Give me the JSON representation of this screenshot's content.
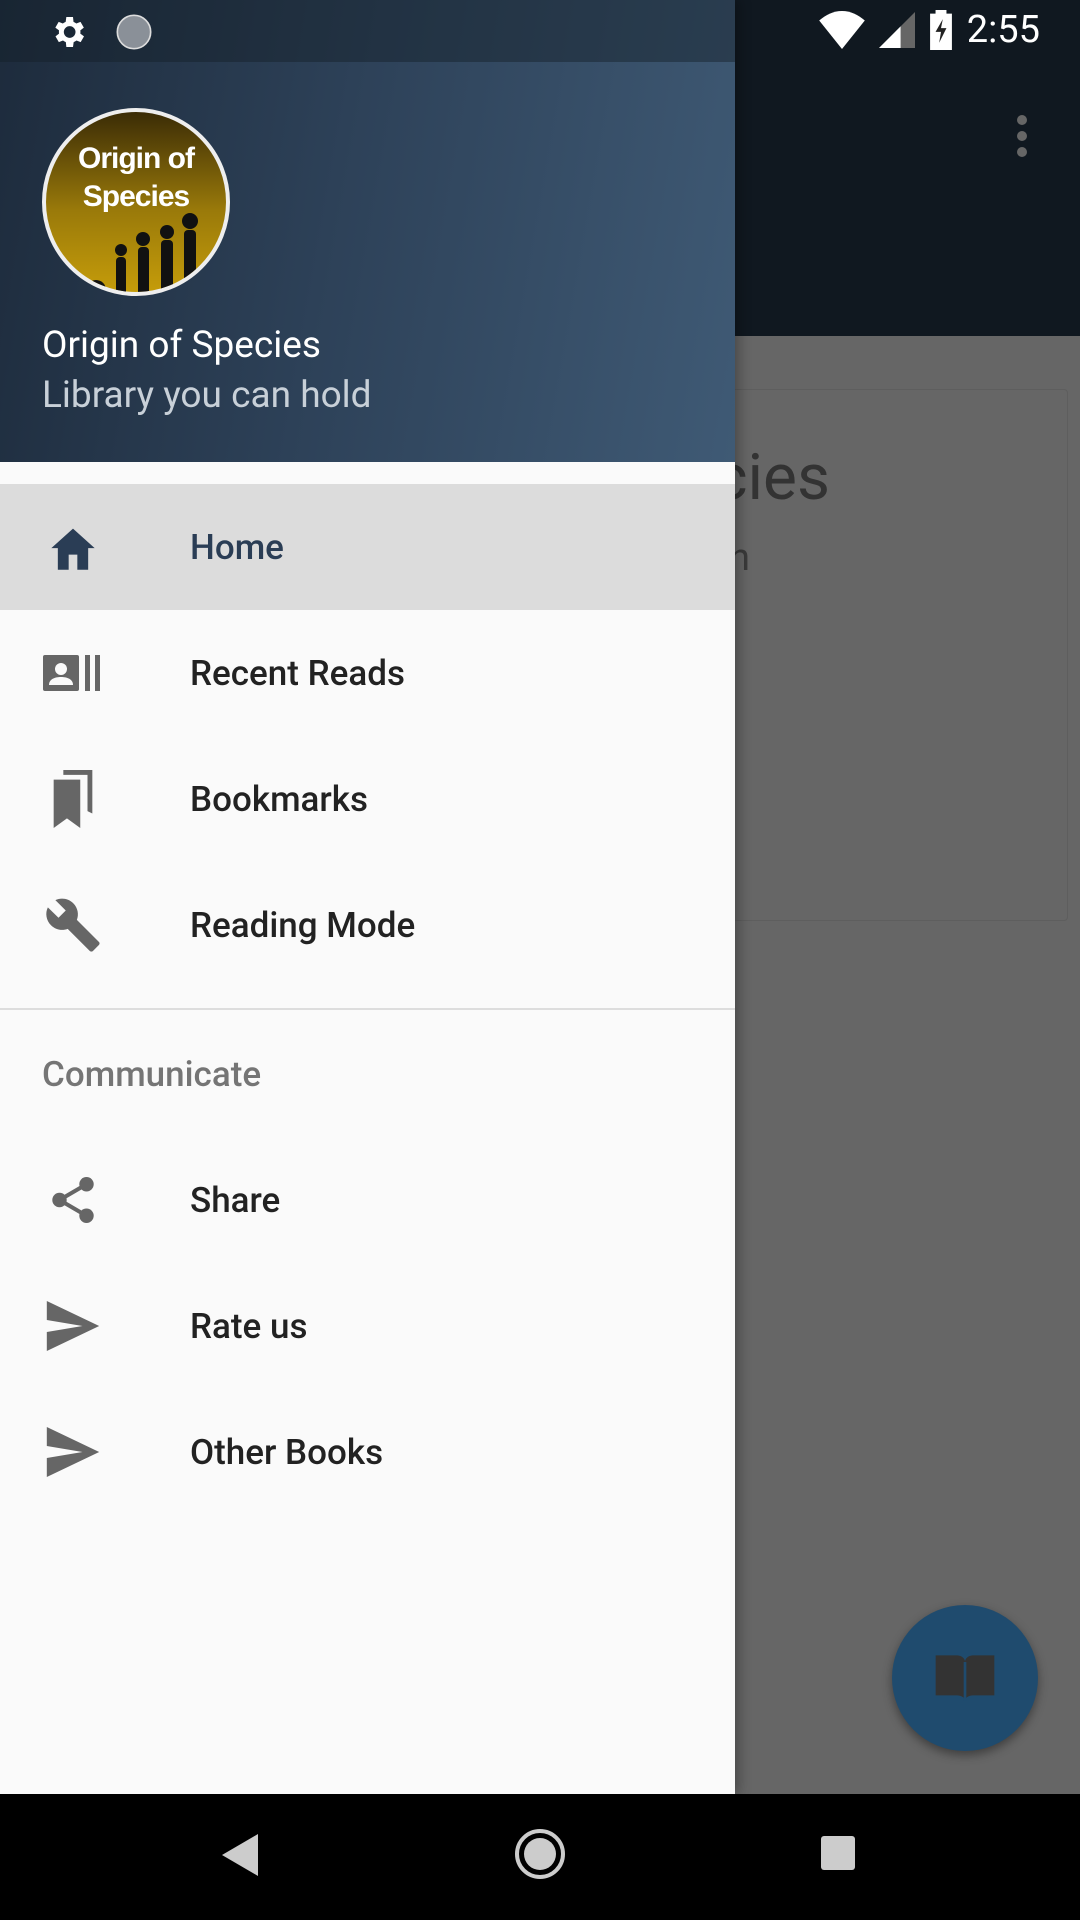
{
  "status_bar": {
    "time": "2:55",
    "left_icons": [
      "gear-icon",
      "sync-icon"
    ],
    "right_icons": [
      "wifi-icon",
      "signal-icon",
      "battery-charging-icon"
    ]
  },
  "background": {
    "title_fragment": "cies",
    "subtitle_fragment": "n",
    "fab_icon": "open-book-icon"
  },
  "drawer": {
    "header": {
      "logo_text_line1": "Origin of",
      "logo_text_line2": "Species",
      "title": "Origin of Species",
      "subtitle": "Library you can hold"
    },
    "items": [
      {
        "label": "Home",
        "icon": "home-icon",
        "active": true
      },
      {
        "label": "Recent Reads",
        "icon": "recent-icon"
      },
      {
        "label": "Bookmarks",
        "icon": "bookmarks-icon"
      },
      {
        "label": "Reading Mode",
        "icon": "wrench-icon"
      }
    ],
    "section_title": "Communicate",
    "communicate_items": [
      {
        "label": "Share",
        "icon": "share-icon"
      },
      {
        "label": "Rate us",
        "icon": "send-icon"
      },
      {
        "label": "Other Books",
        "icon": "send-icon"
      }
    ]
  },
  "colors": {
    "header_start": "#1d2b3c",
    "header_end": "#3f5a75",
    "active_item": "#dcdcdc",
    "fab": "#1f4b6e"
  }
}
